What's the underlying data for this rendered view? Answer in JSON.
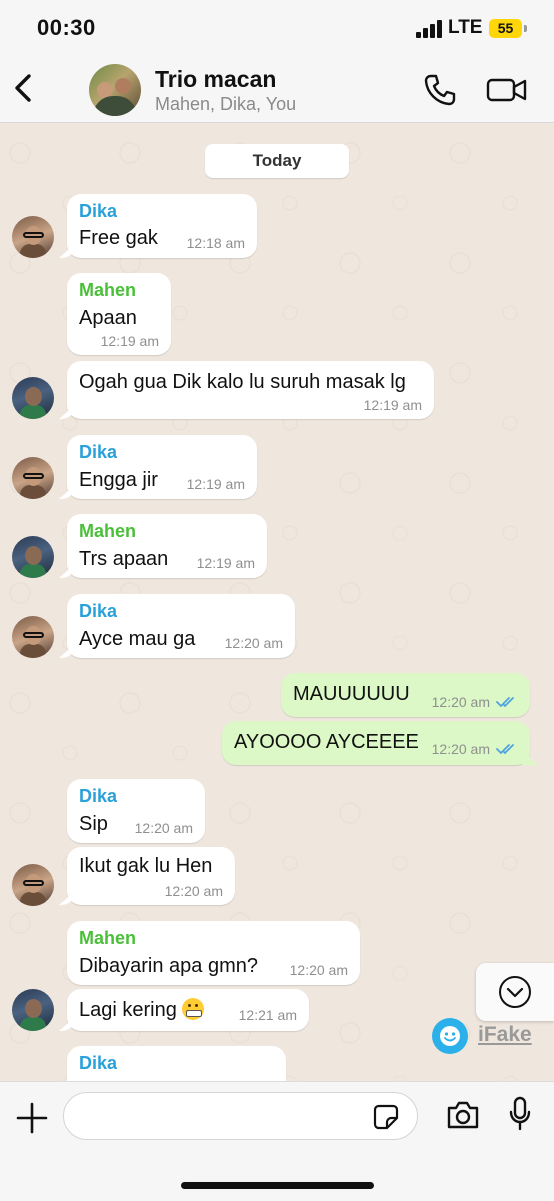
{
  "status_bar": {
    "time": "00:30",
    "network": "LTE",
    "battery": "55",
    "battery_color": "#ffd60a"
  },
  "header": {
    "title": "Trio macan",
    "subtitle": "Mahen, Dika, You"
  },
  "date_separator": "Today",
  "colors": {
    "dika": "#2ba0d9",
    "mahen": "#4bbf3a",
    "outgoing_bubble": "#dcf8c6",
    "read_ticks": "#4fa3e0"
  },
  "messages": [
    {
      "sender": "Dika",
      "text": "Free gak",
      "time": "12:18 am"
    },
    {
      "sender": "Mahen",
      "text": "Apaan",
      "time": "12:19 am"
    },
    {
      "sender": "",
      "text": "Ogah gua Dik kalo lu suruh masak lg",
      "time": "12:19 am"
    },
    {
      "sender": "Dika",
      "text": "Engga jir",
      "time": "12:19 am"
    },
    {
      "sender": "Mahen",
      "text": "Trs apaan",
      "time": "12:19 am"
    },
    {
      "sender": "Dika",
      "text": "Ayce mau ga",
      "time": "12:20 am"
    },
    {
      "sender": "You",
      "text": "MAUUUUUU",
      "time": "12:20 am"
    },
    {
      "sender": "You",
      "text": "AYOOOO AYCEEEE",
      "time": "12:20 am"
    },
    {
      "sender": "Dika",
      "text": "Sip",
      "time": "12:20 am"
    },
    {
      "sender": "",
      "text": "Ikut gak lu Hen",
      "time": "12:20 am"
    },
    {
      "sender": "Mahen",
      "text": "Dibayarin apa gmn?",
      "time": "12:20 am"
    },
    {
      "sender": "",
      "text": "Lagi kering",
      "time": "12:21 am",
      "emoji": "grimacing-face"
    },
    {
      "sender": "Dika",
      "text": "",
      "time": ""
    }
  ],
  "watermark": {
    "label": "iFake"
  },
  "icons": [
    "back-chevron",
    "phone",
    "video-camera",
    "plus",
    "sticker",
    "camera",
    "microphone",
    "chevron-down",
    "double-check"
  ]
}
